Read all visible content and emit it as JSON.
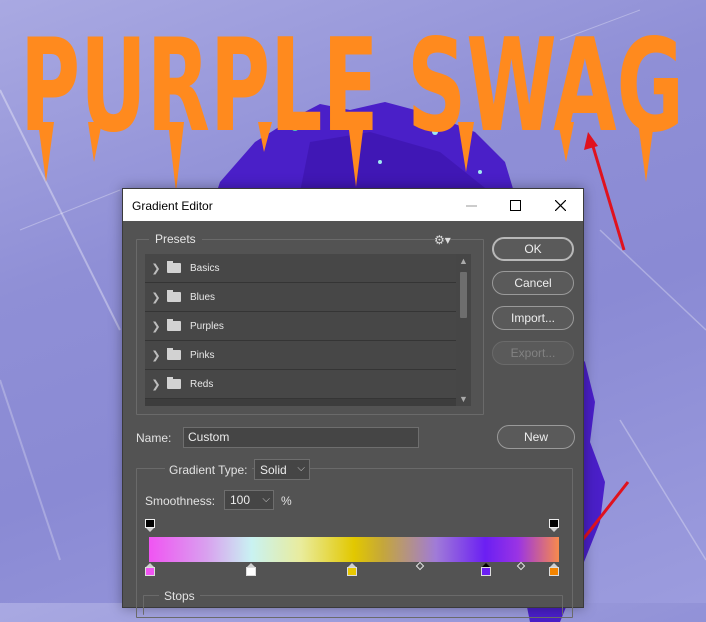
{
  "poster": {
    "title": "PURPLE SWAG",
    "title_color": "#ff8a1e",
    "arrow_color": "#e0121e"
  },
  "dialog": {
    "title": "Gradient Editor",
    "window_controls": [
      "minimize-icon",
      "maximize-icon",
      "close-icon"
    ],
    "presets": {
      "label": "Presets",
      "items": [
        {
          "label": "Basics"
        },
        {
          "label": "Blues"
        },
        {
          "label": "Purples"
        },
        {
          "label": "Pinks"
        },
        {
          "label": "Reds"
        }
      ]
    },
    "buttons": {
      "ok": "OK",
      "cancel": "Cancel",
      "import": "Import...",
      "export": "Export...",
      "new": "New"
    },
    "name": {
      "label": "Name:",
      "value": "Custom"
    },
    "gradient": {
      "type_label": "Gradient Type:",
      "type_value": "Solid",
      "smoothness_label": "Smoothness:",
      "smoothness_value": "100",
      "smoothness_unit": "%",
      "color_stop_colors": [
        "#f054f2",
        "#ffffff",
        "#e8c800",
        "#6b1ff3",
        "#f38400"
      ],
      "stops_label": "Stops"
    }
  }
}
